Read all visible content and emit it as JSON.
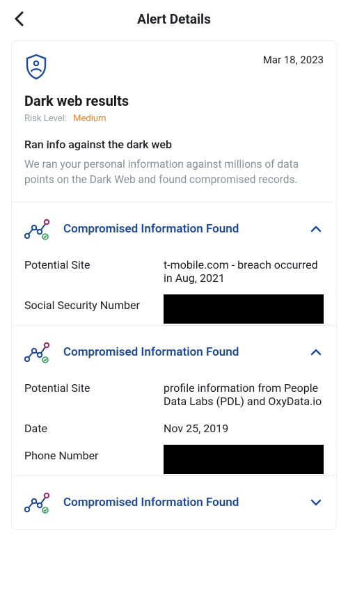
{
  "header": {
    "title": "Alert Details"
  },
  "alert": {
    "date": "Mar 18, 2023",
    "title": "Dark web results",
    "risk_label": "Risk Level:",
    "risk_value": "Medium",
    "subhead": "Ran info against the dark web",
    "body": "We ran your personal information against millions of data points on the Dark Web and found compromised records."
  },
  "sections": [
    {
      "title": "Compromised Information Found",
      "expanded": true,
      "rows": [
        {
          "label": "Potential Site",
          "value": "t-mobile.com - breach occurred in Aug, 2021"
        },
        {
          "label": "Social Security Number",
          "redacted": true
        }
      ]
    },
    {
      "title": "Compromised Information Found",
      "expanded": true,
      "rows": [
        {
          "label": "Potential Site",
          "value": "profile information from People Data Labs (PDL) and OxyData.io"
        },
        {
          "label": "Date",
          "value": "Nov 25, 2019"
        },
        {
          "label": "Phone Number",
          "redacted": true
        }
      ]
    },
    {
      "title": "Compromised Information Found",
      "expanded": false
    }
  ]
}
